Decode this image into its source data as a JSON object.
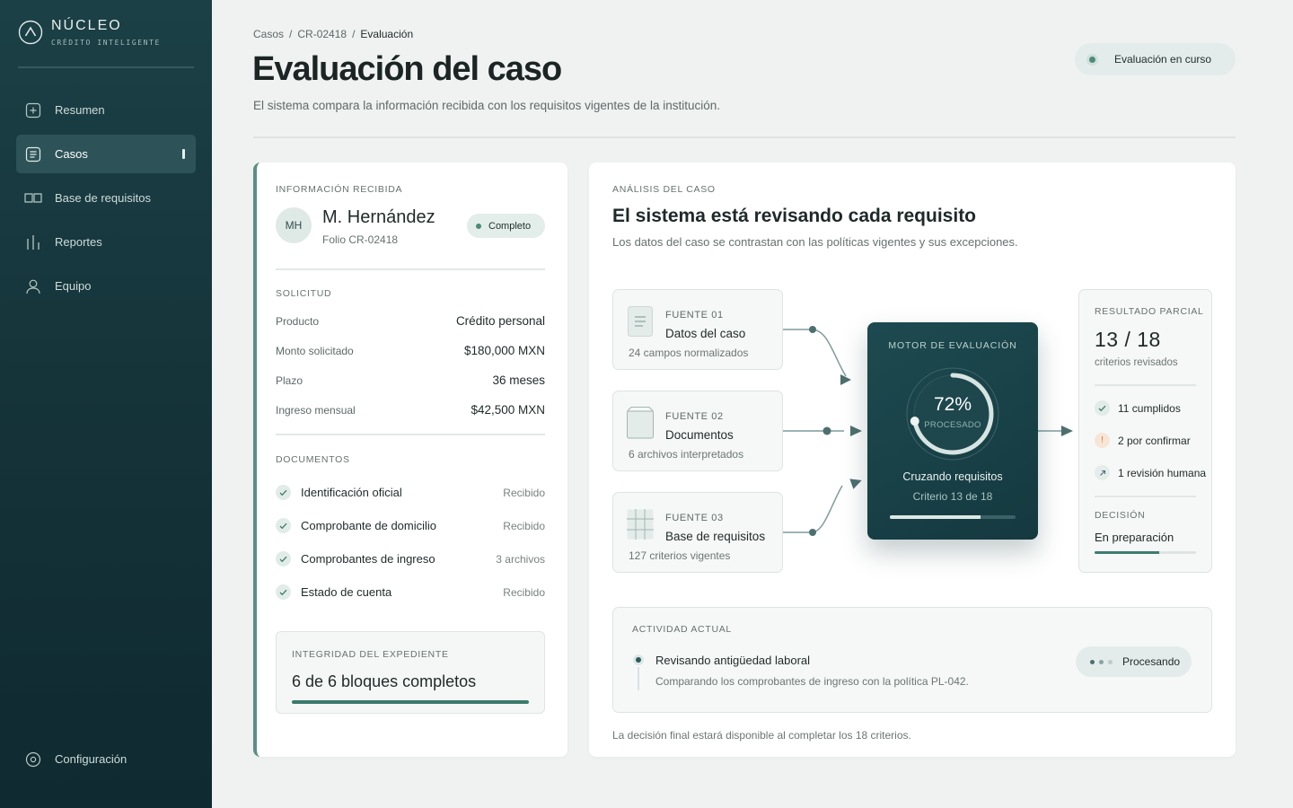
{
  "brand": {
    "name": "NÚCLEO",
    "tagline": "CRÉDITO INTELIGENTE"
  },
  "nav": {
    "items": [
      {
        "label": "Resumen",
        "icon": "plus-square-icon"
      },
      {
        "label": "Casos",
        "icon": "document-icon",
        "active": true
      },
      {
        "label": "Base de requisitos",
        "icon": "book-icon"
      },
      {
        "label": "Reportes",
        "icon": "bar-chart-icon"
      },
      {
        "label": "Equipo",
        "icon": "user-icon"
      }
    ],
    "settings": {
      "label": "Configuración",
      "icon": "settings-icon"
    }
  },
  "header": {
    "breadcrumb": [
      "Casos",
      "CR-02418",
      "Evaluación"
    ],
    "breadcrumb_separator": "/",
    "title": "Evaluación del caso",
    "subtitle": "El sistema compara la información recibida con los requisitos vigentes de la institución.",
    "status": "Evaluación en curso"
  },
  "info": {
    "section_label": "Información recibida",
    "client": {
      "initials": "MH",
      "name": "M. Hernández",
      "folio": "Folio CR-02418",
      "badge": "Completo"
    },
    "request_label": "Solicitud",
    "request": [
      {
        "label": "Producto",
        "value": "Crédito personal"
      },
      {
        "label": "Monto solicitado",
        "value": "$180,000 MXN"
      },
      {
        "label": "Plazo",
        "value": "36 meses"
      },
      {
        "label": "Ingreso mensual",
        "value": "$42,500 MXN"
      }
    ],
    "documents_label": "Documentos",
    "documents": [
      {
        "name": "Identificación oficial",
        "status": "Recibido"
      },
      {
        "name": "Comprobante de domicilio",
        "status": "Recibido"
      },
      {
        "name": "Comprobantes de ingreso",
        "status": "3 archivos"
      },
      {
        "name": "Estado de cuenta",
        "status": "Recibido"
      }
    ],
    "integrity": {
      "label": "Integridad del expediente",
      "value": "6 de 6 bloques completos",
      "progress": 1.0
    }
  },
  "analysis": {
    "section_label": "Análisis del caso",
    "title": "El sistema está revisando cada requisito",
    "subtitle": "Los datos del caso se contrastan con las políticas vigentes y sus excepciones.",
    "sources": [
      {
        "label": "FUENTE 01",
        "name": "Datos del caso",
        "desc": "24 campos normalizados",
        "icon": "list-document-icon"
      },
      {
        "label": "FUENTE 02",
        "name": "Documentos",
        "desc": "6 archivos interpretados",
        "icon": "box-icon"
      },
      {
        "label": "FUENTE 03",
        "name": "Base de requisitos",
        "desc": "127 criterios vigentes",
        "icon": "grid-icon"
      }
    ],
    "engine": {
      "label": "MOTOR DE EVALUACIÓN",
      "percent": "72%",
      "percent_value": 0.72,
      "processed": "PROCESADO",
      "status": "Cruzando requisitos",
      "criterion": "Criterio 13 de 18",
      "progress": 0.72
    },
    "result": {
      "label": "RESULTADO PARCIAL",
      "value": "13 / 18",
      "caption": "criterios revisados",
      "items": [
        {
          "text": "11 cumplidos",
          "icon": "check-icon"
        },
        {
          "text": "2 por confirmar",
          "icon": "exclamation-icon"
        },
        {
          "text": "1 revisión humana",
          "icon": "arrow-up-right-icon"
        }
      ],
      "decision_label": "DECISIÓN",
      "decision": "En preparación",
      "decision_progress": 0.64
    },
    "activity": {
      "label": "ACTIVIDAD ACTUAL",
      "title": "Revisando antigüedad laboral",
      "desc": "Comparando los comprobantes de ingreso con la política PL-042.",
      "status": "Procesando"
    },
    "footnote": "La decisión final estará disponible al completar los 18 criterios."
  },
  "colors": {
    "sidebar": "#173a40",
    "accent": "#3b7a6c",
    "engine": "#1a434a",
    "warning": "#d98a4a",
    "background": "#f0f2f1"
  }
}
